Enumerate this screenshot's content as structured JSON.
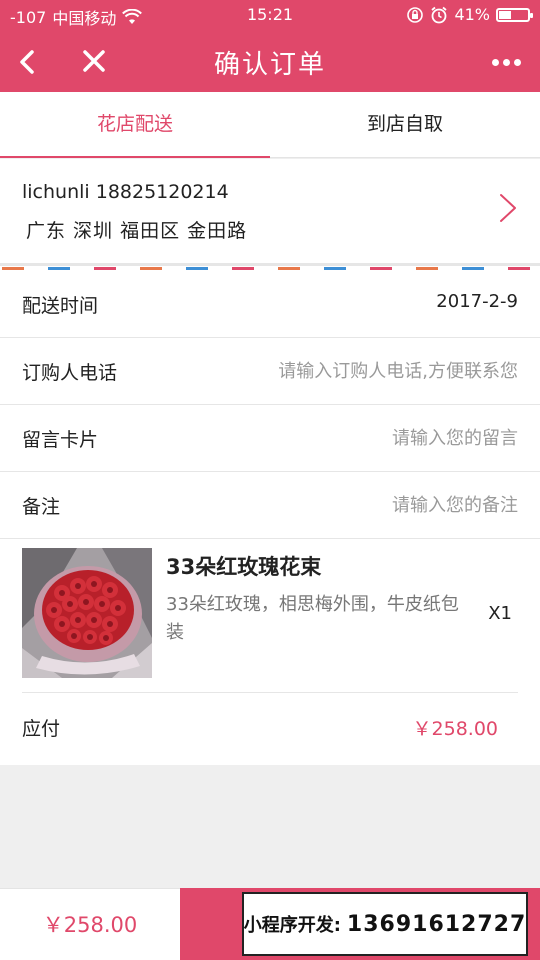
{
  "status_bar": {
    "signal": "-107",
    "carrier": "中国移动",
    "time": "15:21",
    "battery": "41%",
    "icons": [
      "wifi-icon",
      "rotation-lock-icon",
      "alarm-icon",
      "battery-icon"
    ]
  },
  "nav": {
    "title": "确认订单",
    "icons": [
      "back-icon",
      "close-icon",
      "more-icon"
    ]
  },
  "tabs": [
    {
      "label": "花店配送",
      "active": true
    },
    {
      "label": "到店自取",
      "active": false
    }
  ],
  "address": {
    "name_phone": "lichunli 18825120214",
    "detail": "广东 深圳 福田区 金田路"
  },
  "fields": {
    "delivery_time": {
      "label": "配送时间",
      "value": "2017-2-9"
    },
    "buyer_phone": {
      "label": "订购人电话",
      "placeholder": "请输入订购人电话,方便联系您"
    },
    "message_card": {
      "label": "留言卡片",
      "placeholder": "请输入您的留言"
    },
    "note": {
      "label": "备注",
      "placeholder": "请输入您的备注"
    }
  },
  "product": {
    "name": "33朵红玫瑰花束",
    "description": "33朵红玫瑰，相思梅外围，牛皮纸包装",
    "quantity": "X1"
  },
  "payment": {
    "label": "应付",
    "amount": "￥258.00"
  },
  "bottom_bar": {
    "total": "￥258.00",
    "promo_label": "小程序开发:",
    "promo_phone": "13691612727"
  },
  "colors": {
    "accent": "#e0486a",
    "background": "#efefef",
    "placeholder": "#9a9a9a"
  }
}
